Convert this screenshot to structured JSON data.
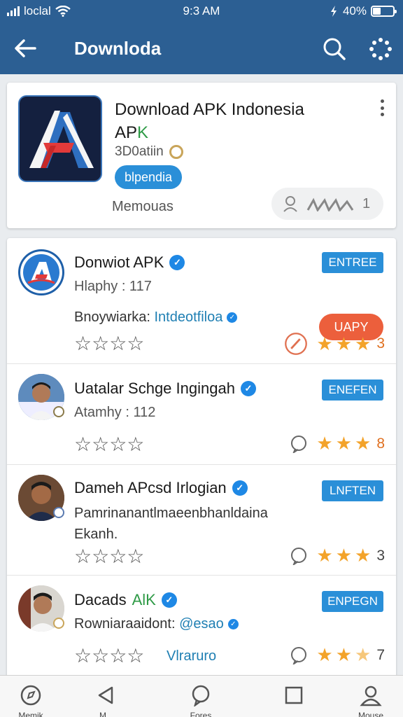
{
  "status_bar": {
    "carrier": "loclal",
    "time": "9:3 AM",
    "battery": "40%",
    "battery_level": 0.4
  },
  "app_bar": {
    "title": "Downloda"
  },
  "featured": {
    "name": "Download APK Indonesia",
    "name_suffix": "APK",
    "size": "3D0atiin",
    "tag": "blpendia",
    "subtitle": "Memouas",
    "stat_count": "1"
  },
  "items": [
    {
      "title": "Donwiot APK",
      "meta": "Hlaphy : 117",
      "desc_prefix": "Bnoywiarka: ",
      "desc_link": "Intdeotfiloa",
      "button": "ENTREE",
      "secondary_button": "UAPY",
      "rating": "3",
      "stars": 3
    },
    {
      "title": "Uatalar Schge Ingingah",
      "meta": "Atamhy : 112",
      "button": "ENEFEN",
      "rating": "8",
      "stars": 3
    },
    {
      "title": "Dameh APcsd Irlogian",
      "desc": "Pamrinanantlmaeenbhanldaina Ekanh.",
      "button": "LNFTEN",
      "rating": "3",
      "stars": 3
    },
    {
      "title": "Dacads",
      "title_suffix": "AlK",
      "desc_prefix": "Rowniaraaidont: ",
      "desc_link": "@esao",
      "button": "ENPEGN",
      "link_below": "Vlraruro",
      "rating": "7",
      "stars": 2.5
    }
  ],
  "bottom_nav": [
    {
      "label": "Memik",
      "icon": "compass-icon"
    },
    {
      "label": "M...",
      "icon": "back-triangle-icon"
    },
    {
      "label": "Fores",
      "icon": "chat-icon"
    },
    {
      "label": "",
      "icon": "square-icon"
    },
    {
      "label": "Mouse",
      "icon": "profile-icon"
    }
  ],
  "colors": {
    "primary": "#2c5f93",
    "accent": "#2a8fd8",
    "star": "#f3a32a",
    "warn": "#ec5f3c"
  }
}
